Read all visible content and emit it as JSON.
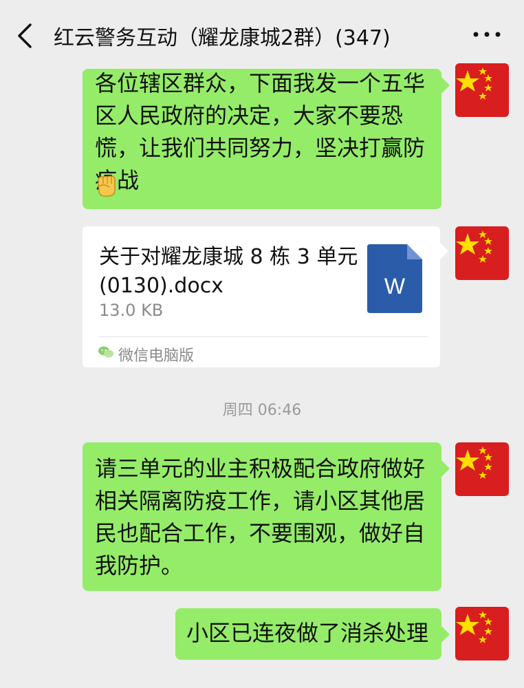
{
  "header": {
    "title": "红云警务互动（耀龙康城2群）(347)",
    "back_icon": "chevron-left-icon",
    "more_icon": "more-dots-icon"
  },
  "messages": [
    {
      "type": "text",
      "sender": "self",
      "text": "各位辖区群众，下面我发一个五华区人民政府的决定，大家不要恐慌，让我们共同努力，坚决打赢防疫战",
      "emoji": "raised-fist"
    },
    {
      "type": "file",
      "sender": "self",
      "file_name": "关于对耀龙康城 8 栋 3 单元(0130).docx",
      "file_size": "13.0 KB",
      "file_icon": "word-doc-icon",
      "file_badge": "W",
      "source": "微信电脑版"
    },
    {
      "type": "timestamp",
      "text": "周四 06:46"
    },
    {
      "type": "text",
      "sender": "self",
      "text": "请三单元的业主积极配合政府做好相关隔离防疫工作，请小区其他居民也配合工作，不要围观，做好自我防护。"
    },
    {
      "type": "text",
      "sender": "self",
      "text": "小区已连夜做了消杀处理"
    }
  ],
  "colors": {
    "background": "#ededed",
    "self_bubble": "#95ec69",
    "file_card": "#ffffff",
    "word_blue": "#2a5caa",
    "avatar_red": "#d81e1e",
    "star_yellow": "#ffde00"
  }
}
